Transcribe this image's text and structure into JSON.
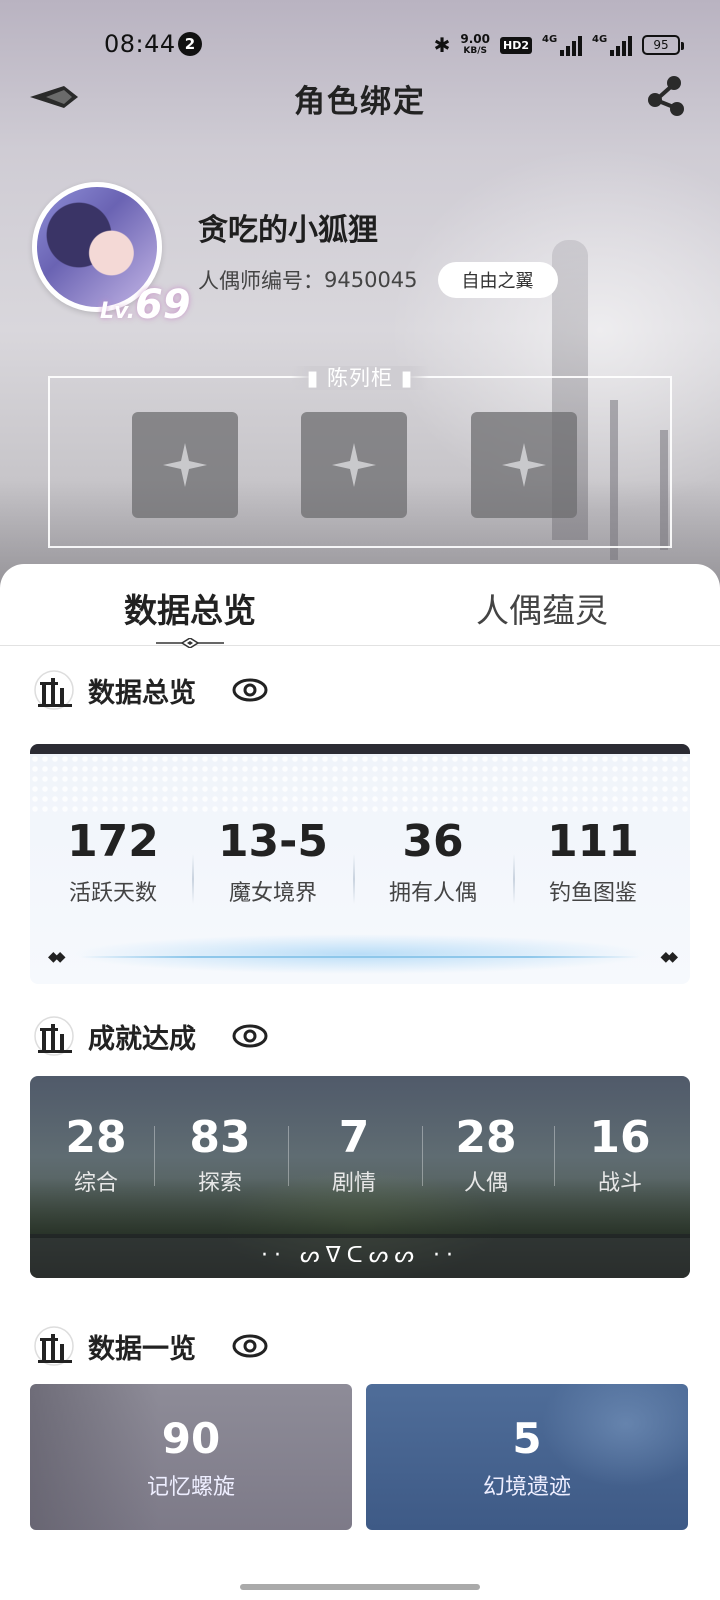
{
  "status_bar": {
    "time": "08:44",
    "notification_count": "2",
    "net_speed_value": "9.00",
    "net_speed_unit": "KB/S",
    "hd_label": "HD2",
    "signal1_label": "4G",
    "signal2_label": "4G",
    "battery": "95"
  },
  "header": {
    "title": "角色绑定"
  },
  "profile": {
    "username": "贪吃的小狐狸",
    "id_label": "人偶师编号：",
    "id_value": "9450045",
    "server": "自由之翼",
    "level_prefix": "Lv.",
    "level": "69"
  },
  "showcase": {
    "title": "陈列柜",
    "slots": [
      "empty",
      "empty",
      "empty"
    ]
  },
  "tabs": [
    {
      "label": "数据总览",
      "active": true
    },
    {
      "label": "人偶蕴灵",
      "active": false
    }
  ],
  "overview": {
    "title": "数据总览",
    "stats": [
      {
        "value": "172",
        "label": "活跃天数"
      },
      {
        "value": "13-5",
        "label": "魔女境界"
      },
      {
        "value": "36",
        "label": "拥有人偶"
      },
      {
        "value": "111",
        "label": "钓鱼图鉴"
      }
    ]
  },
  "achievements": {
    "title": "成就达成",
    "items": [
      {
        "value": "28",
        "label": "综合"
      },
      {
        "value": "83",
        "label": "探索"
      },
      {
        "value": "7",
        "label": "剧情"
      },
      {
        "value": "28",
        "label": "人偶"
      },
      {
        "value": "16",
        "label": "战斗"
      }
    ],
    "footer_glyphs": "·· ᔕᐁᑕᔕᔕ ··"
  },
  "data_list": {
    "title": "数据一览",
    "cards": [
      {
        "value": "90",
        "label": "记忆螺旋"
      },
      {
        "value": "5",
        "label": "幻境遗迹"
      }
    ]
  },
  "colors": {
    "accent_dark": "#2b2b33",
    "ruins_blue": "#4f6d99",
    "memory_grey": "#8e8c98"
  },
  "icons": {
    "back": "back-arrow-icon",
    "share": "share-icon",
    "eye": "eye-icon",
    "section": "ruins-icon",
    "slot": "sparkle-icon"
  }
}
